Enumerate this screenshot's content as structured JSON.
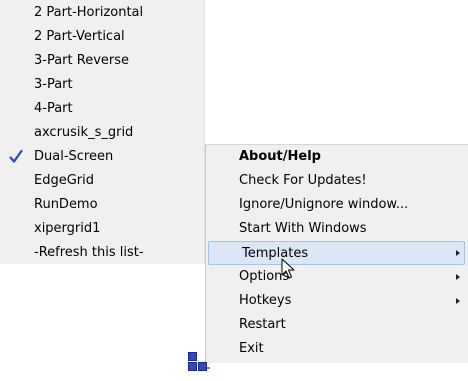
{
  "templates_menu": {
    "items": [
      {
        "label": "2 Part-Horizontal",
        "checked": false
      },
      {
        "label": "2 Part-Vertical",
        "checked": false
      },
      {
        "label": "3-Part Reverse",
        "checked": false
      },
      {
        "label": "3-Part",
        "checked": false
      },
      {
        "label": "4-Part",
        "checked": false
      },
      {
        "label": "axcrusik_s_grid",
        "checked": false
      },
      {
        "label": "Dual-Screen",
        "checked": true
      },
      {
        "label": "EdgeGrid",
        "checked": false
      },
      {
        "label": "RunDemo",
        "checked": false
      },
      {
        "label": "xipergrid1",
        "checked": false
      },
      {
        "label": "-Refresh this list-",
        "checked": false
      }
    ]
  },
  "context_menu": {
    "items": [
      {
        "label": "About/Help",
        "bold": true,
        "submenu": false
      },
      {
        "label": "Check For Updates!",
        "bold": false,
        "submenu": false
      },
      {
        "label": "Ignore/Unignore window...",
        "bold": false,
        "submenu": false
      },
      {
        "label": "Start With Windows",
        "bold": false,
        "submenu": false
      },
      {
        "label": "Templates",
        "bold": false,
        "submenu": true,
        "highlighted": true
      },
      {
        "label": "Options",
        "bold": false,
        "submenu": true
      },
      {
        "label": "Hotkeys",
        "bold": false,
        "submenu": true
      },
      {
        "label": "Restart",
        "bold": false,
        "submenu": false
      },
      {
        "label": "Exit",
        "bold": false,
        "submenu": false
      }
    ]
  },
  "icons": {
    "check": "checkmark-icon",
    "submenu_arrow": "chevron-right-icon",
    "cursor": "mouse-pointer-icon",
    "tray": "gridmove-tray-icon"
  },
  "colors": {
    "menu_background": "#f0f0f0",
    "highlight_fill": "#dbe7f7",
    "highlight_border": "#a6c3ea",
    "check_color": "#1a50b8",
    "tray_icon_color": "#1c2a8c"
  }
}
